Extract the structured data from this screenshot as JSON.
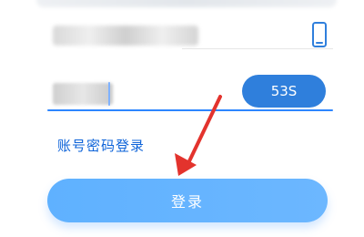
{
  "phone": {
    "value_masked": ""
  },
  "code": {
    "value_masked": "",
    "countdown_label": "53S"
  },
  "links": {
    "account_password_login": "账号密码登录"
  },
  "login": {
    "button_label": "登录"
  },
  "colors": {
    "primary_blue": "#2f7fdc",
    "link_blue": "#0f64d9",
    "button_blue": "#64b4ff",
    "annotation_red": "#e3332d",
    "underline_blue": "#2d86ff"
  },
  "icons": {
    "phone_icon": "phone-icon",
    "annotation_arrow": "red-arrow-icon"
  }
}
